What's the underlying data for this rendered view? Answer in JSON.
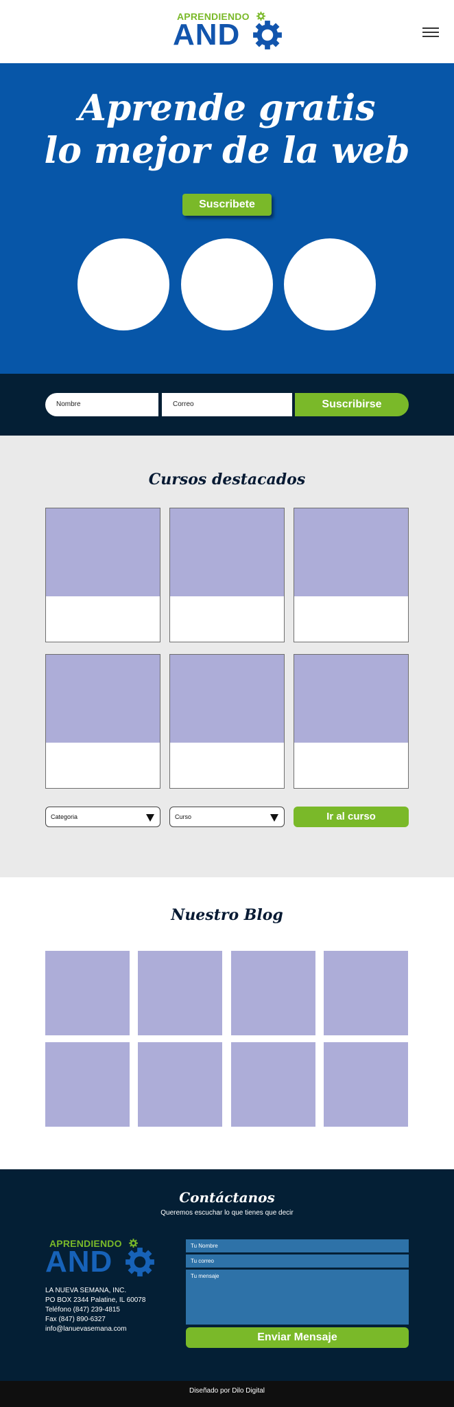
{
  "brand": {
    "logo_small": "APRENDIENDO",
    "logo_big": "AND",
    "colors": {
      "primary_blue": "#0756a8",
      "accent_green": "#7ab929",
      "dark_navy": "#041f35",
      "placeholder_lilac": "#adadd8"
    }
  },
  "header": {
    "menu_icon": "hamburger-menu-icon"
  },
  "hero": {
    "title_line1": "Aprende gratis",
    "title_line2": "lo mejor de la web",
    "cta_label": "Suscribete"
  },
  "subscribe": {
    "name_placeholder": "Nombre",
    "email_placeholder": "Correo",
    "button_label": "Suscribirse"
  },
  "courses": {
    "title": "Cursos destacados",
    "category_select": "Categoria",
    "course_select": "Curso",
    "go_button": "Ir al curso"
  },
  "blog": {
    "title": "Nuestro Blog"
  },
  "contact": {
    "title": "Contáctanos",
    "subtitle": "Queremos escuchar lo que tienes que decir",
    "address": [
      "LA NUEVA SEMANA, INC.",
      "PO BOX 2344 Palatine, IL 60078",
      "Teléfono (847) 239-4815",
      "Fax (847) 890-6327",
      "info@lanuevasemana.com"
    ],
    "name_placeholder": "Tu Nombre",
    "email_placeholder": "Tu correo",
    "message_placeholder": "Tu mensaje",
    "send_button": "Enviar Mensaje"
  },
  "footer": {
    "credit": "Diseñado por Dilo Digital"
  }
}
